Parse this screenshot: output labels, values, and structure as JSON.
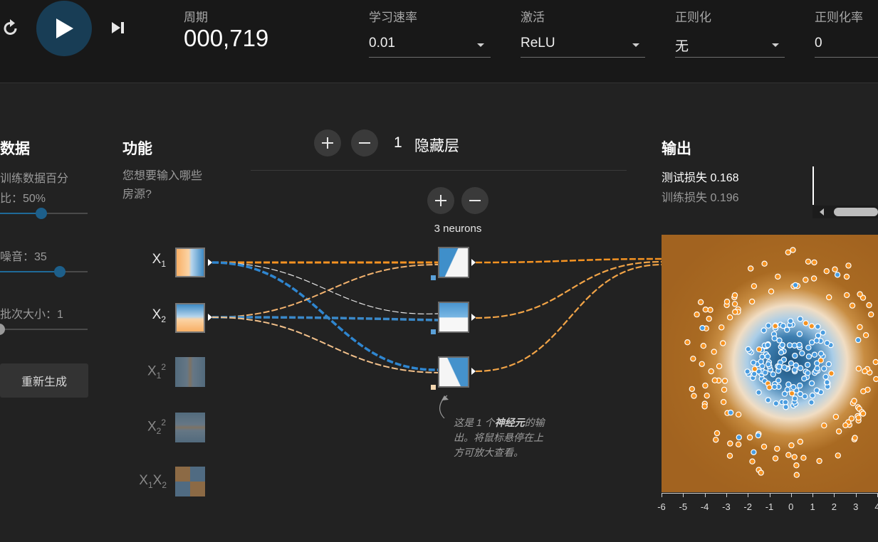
{
  "toolbar": {
    "epoch_label": "周期",
    "epoch_value": "000,719",
    "learning_rate": {
      "label": "学习速率",
      "value": "0.01"
    },
    "activation": {
      "label": "激活",
      "value": "ReLU"
    },
    "regularization": {
      "label": "正则化",
      "value": "无"
    },
    "regularization_rate": {
      "label": "正则化率",
      "value": "0"
    }
  },
  "data_panel": {
    "title": "数据",
    "train_ratio_label": "训练数据百分",
    "train_ratio_value": "比：50%",
    "noise_label": "噪音：35",
    "batch_label": "批次大小：1",
    "regenerate_label": "重新生成",
    "train_ratio": 0.5,
    "noise": 35,
    "batch_size": 1
  },
  "features": {
    "title": "功能",
    "subtitle_line1": "您想要输入哪些",
    "subtitle_line2": "房源?",
    "items": [
      {
        "main": "X",
        "sub": "1",
        "sup": "",
        "active": true
      },
      {
        "main": "X",
        "sub": "2",
        "sup": "",
        "active": true
      },
      {
        "main": "X",
        "sub": "1",
        "sup": "2",
        "active": false
      },
      {
        "main": "X",
        "sub": "2",
        "sup": "2",
        "active": false
      },
      {
        "main": "X",
        "sub": "1",
        "sup": "",
        "main2": "X",
        "sub2": "2",
        "active": false
      }
    ]
  },
  "network": {
    "hidden_layers_count": "1",
    "hidden_layers_label": "隐藏层",
    "neurons_label": "3 neurons",
    "annotation": {
      "prefix": "这是 1 个",
      "bold": "神经元",
      "suffix": "的输出。将鼠标悬停在上方可放大查看。"
    }
  },
  "output": {
    "title": "输出",
    "test_loss_label": "测试损失",
    "test_loss_value": "0.168",
    "train_loss_label": "训练损失",
    "train_loss_value": "0.196",
    "x_ticks": [
      "-6",
      "-5",
      "-4",
      "-3",
      "-2",
      "-1",
      "0",
      "1",
      "2",
      "3",
      "4"
    ]
  },
  "colors": {
    "orange": "#f59322",
    "blue": "#0877bd",
    "light_blue": "#7bb5e0",
    "play_bg": "#183d55",
    "bg": "#222222",
    "topbar": "#181818"
  },
  "icons": [
    "reset-icon",
    "play-icon",
    "step-icon",
    "plus-icon",
    "minus-icon",
    "chevron-left-icon"
  ]
}
